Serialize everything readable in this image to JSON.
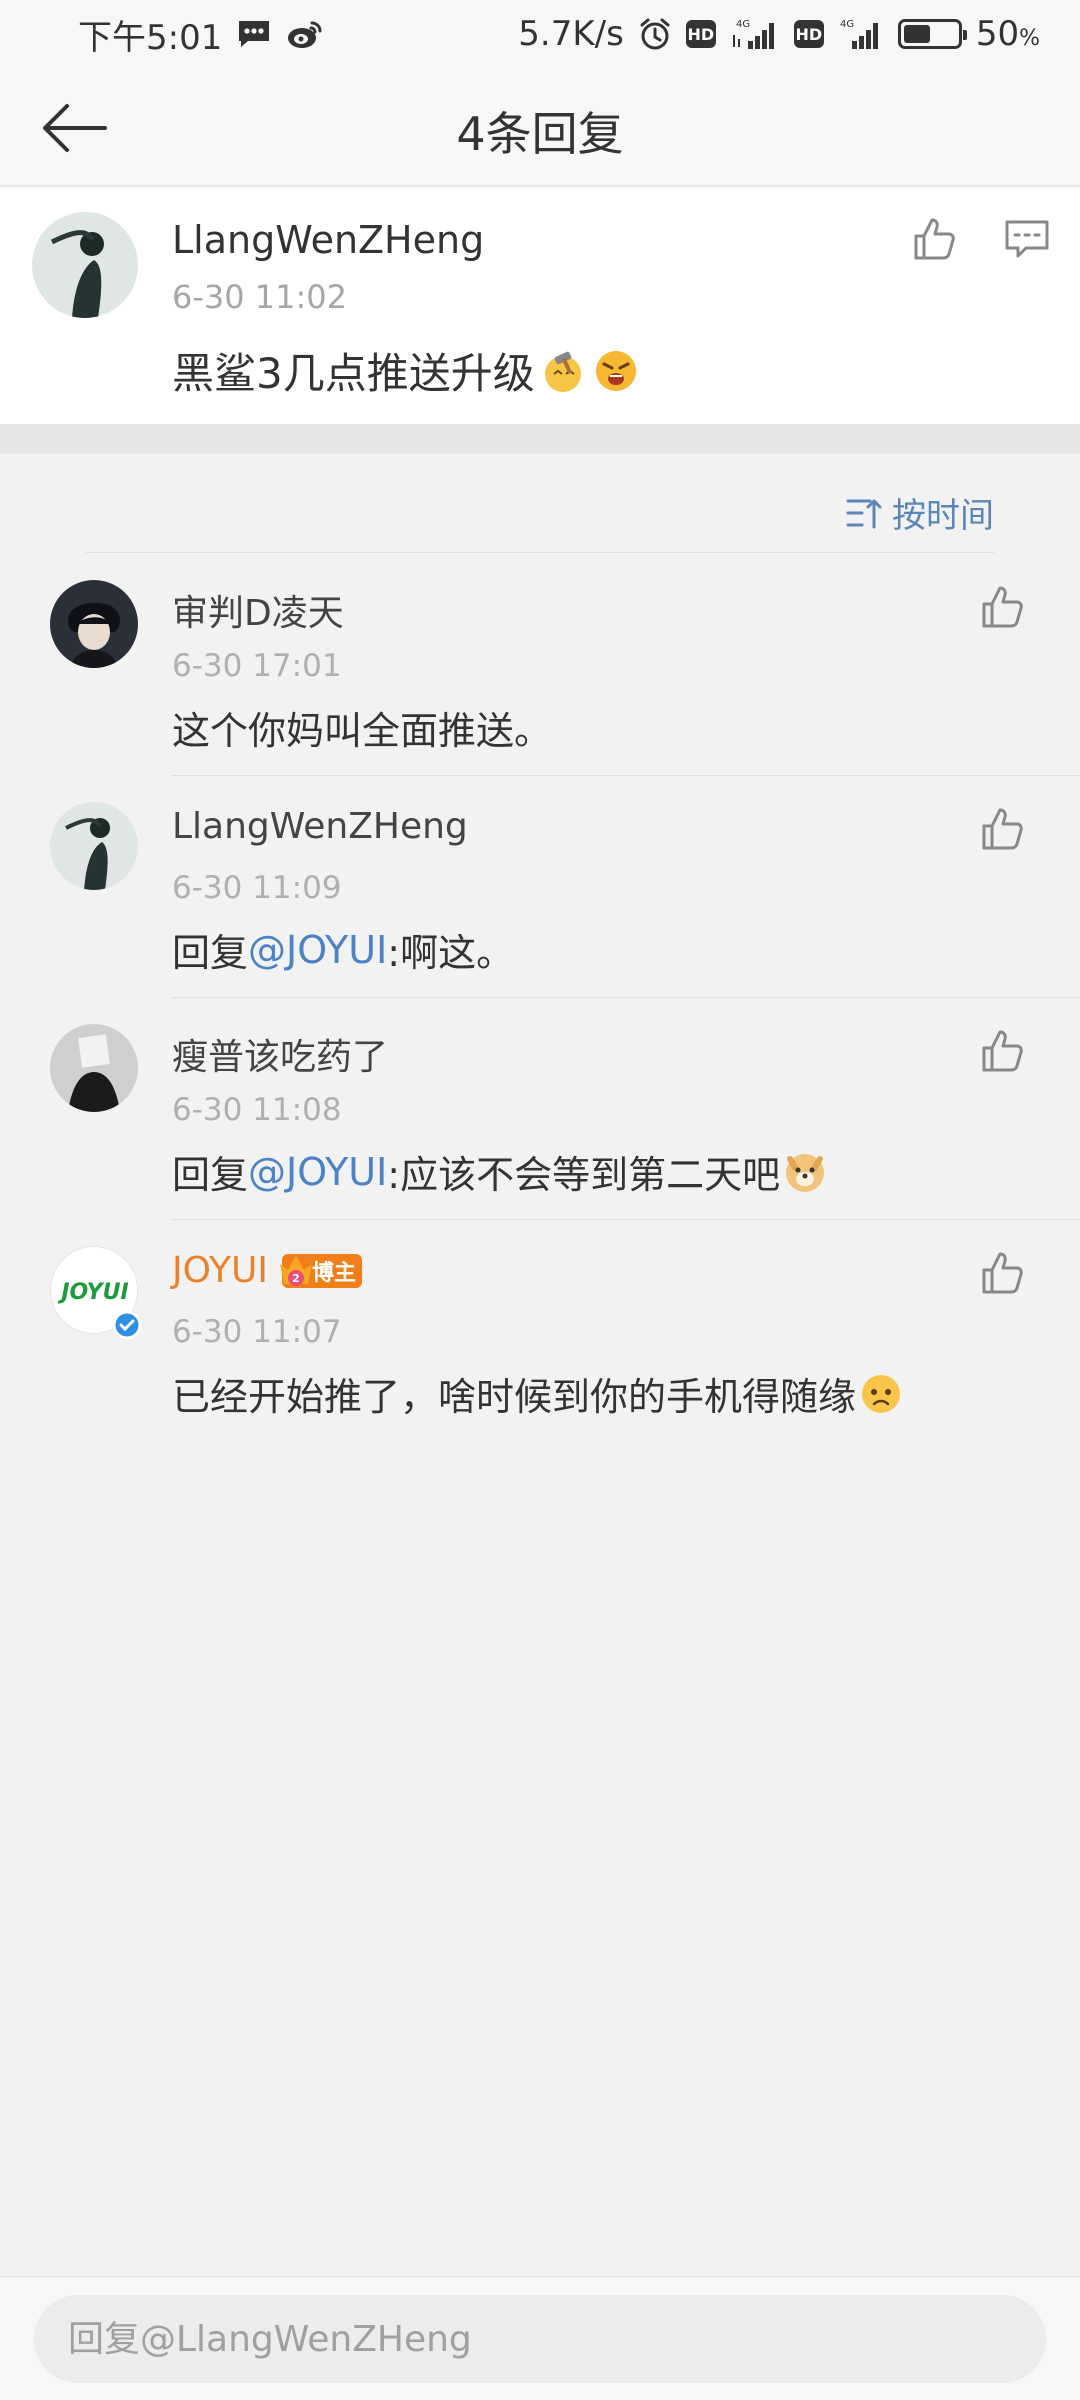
{
  "status_bar": {
    "time": "下午5:01",
    "net_speed": "5.7K/s",
    "hd1": "HD",
    "hd2": "HD",
    "lte1": "4G",
    "lte2": "4G",
    "battery_percent": 50,
    "battery_text": "50",
    "percent_sign": "%"
  },
  "header": {
    "title": "4条回复"
  },
  "post": {
    "user": "LlangWenZHeng",
    "time": "6-30 11:02",
    "text": "黑鲨3几点推送升级"
  },
  "sort": {
    "label": "按时间"
  },
  "replies": [
    {
      "user": "审判D凌天",
      "time": "6-30 17:01",
      "text": "这个你妈叫全面推送。"
    },
    {
      "user": "LlangWenZHeng",
      "time": "6-30 11:09",
      "prefix": "回复",
      "mention": "@JOYUI",
      "text": ":啊这。"
    },
    {
      "user": "瘦普该吃药了",
      "time": "6-30 11:08",
      "prefix": "回复",
      "mention": "@JOYUI",
      "text": ":应该不会等到第二天吧"
    },
    {
      "user": "JOYUI",
      "badge": "博主",
      "time": "6-30 11:07",
      "text": "已经开始推了，啥时候到你的手机得随缘"
    }
  ],
  "avatar_logo": "JOYUI",
  "bottom": {
    "placeholder": "回复@LlangWenZHeng"
  },
  "colors": {
    "mention": "#4b82c4",
    "sort": "#5b87b8",
    "blogger": "#e9812d",
    "badge": "#f07f1a"
  }
}
